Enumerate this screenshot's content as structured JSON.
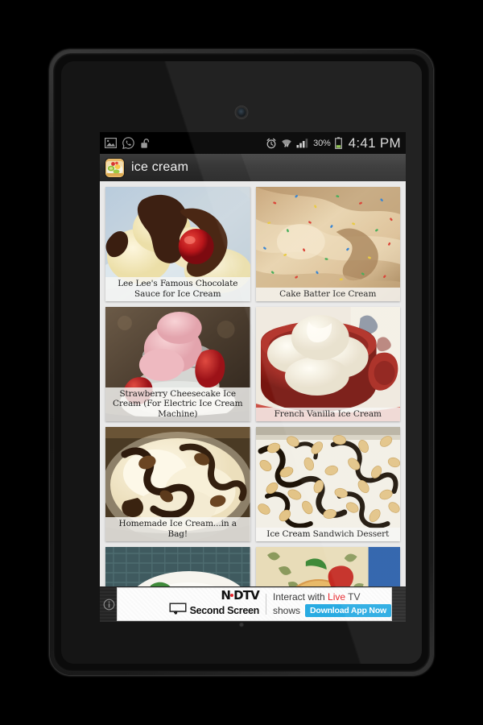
{
  "device": {
    "name": "android-tablet"
  },
  "statusbar": {
    "left_icons": [
      {
        "name": "gallery-image-icon"
      },
      {
        "name": "whatsapp-icon"
      },
      {
        "name": "unlock-icon"
      }
    ],
    "right_icons": [
      {
        "name": "alarm-clock-icon"
      },
      {
        "name": "wifi-icon"
      },
      {
        "name": "cellular-signal-icon"
      }
    ],
    "battery_percent": "30%",
    "battery_icon": "battery-icon",
    "clock": "4:41 PM"
  },
  "actionbar": {
    "app_icon": "fruit-tart-app-icon",
    "title": "ice cream"
  },
  "grid": {
    "cards": [
      {
        "title": "Lee Lee's Famous Chocolate Sauce for Ice Cream",
        "image": "vanilla-ice-cream-with-chocolate-sauce-and-cherry"
      },
      {
        "title": "Cake Batter Ice Cream",
        "image": "beige-ice-cream-with-rainbow-sprinkles"
      },
      {
        "title": "Strawberry Cheesecake Ice Cream (For Electric Ice Cream Machine)",
        "image": "pink-ice-cream-in-glass-dish-with-strawberries"
      },
      {
        "title": "French Vanilla Ice Cream",
        "image": "white-ice-cream-scoops-in-red-bowl"
      },
      {
        "title": "Homemade Ice Cream...in a Bag!",
        "image": "vanilla-ice-cream-with-chocolate-swirl-in-bowl"
      },
      {
        "title": "Ice Cream Sandwich Dessert",
        "image": "cream-dessert-with-chocolate-swirls-and-peanuts"
      },
      {
        "title": "",
        "image": "plate-with-strawberry-partial"
      },
      {
        "title": "",
        "image": "fried-dessert-ball-partial"
      }
    ]
  },
  "ad": {
    "info_icon": "info-icon",
    "brand": "NDTV",
    "brand_sub": "Second Screen",
    "tv_icon": "tv-plus-icon",
    "headline_part1": "Interact with ",
    "headline_live": "Live",
    "headline_part2": " TV",
    "headline_line2": "shows",
    "cta": "Download App Now"
  },
  "colors": {
    "accent_blue": "#29abe2",
    "ndtv_red": "#e8262c",
    "screen_bg": "#e9e9e9",
    "actionbar": "#2c2c2c"
  }
}
